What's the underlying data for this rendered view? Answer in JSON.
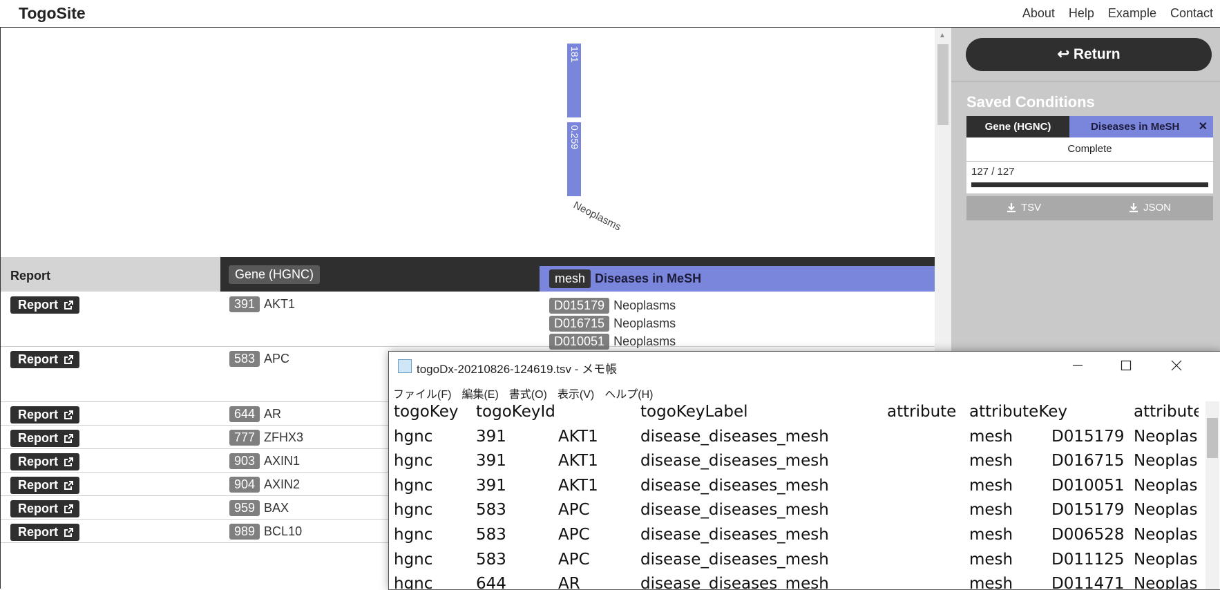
{
  "header": {
    "logo": "TogoSite",
    "nav": [
      "About",
      "Help",
      "Example",
      "Contact"
    ]
  },
  "chart_data": {
    "type": "bar",
    "categories": [
      "Neoplasms"
    ],
    "bar_labels": [
      "181",
      "0.259"
    ],
    "colors": {
      "bar": "#7a86dc"
    }
  },
  "table": {
    "headers": {
      "report": "Report",
      "gene": "Gene (HGNC)",
      "mesh_prefix": "mesh",
      "mesh": "Diseases in MeSH"
    },
    "report_label": "Report",
    "rows": [
      {
        "gene_id": "391",
        "gene_symbol": "AKT1",
        "mesh": [
          {
            "id": "D015179",
            "label": "Neoplasms"
          },
          {
            "id": "D016715",
            "label": "Neoplasms"
          },
          {
            "id": "D010051",
            "label": "Neoplasms"
          }
        ]
      },
      {
        "gene_id": "583",
        "gene_symbol": "APC",
        "mesh": []
      },
      {
        "gene_id": "644",
        "gene_symbol": "AR",
        "mesh": []
      },
      {
        "gene_id": "777",
        "gene_symbol": "ZFHX3",
        "mesh": []
      },
      {
        "gene_id": "903",
        "gene_symbol": "AXIN1",
        "mesh": []
      },
      {
        "gene_id": "904",
        "gene_symbol": "AXIN2",
        "mesh": []
      },
      {
        "gene_id": "959",
        "gene_symbol": "BAX",
        "mesh": []
      },
      {
        "gene_id": "989",
        "gene_symbol": "BCL10",
        "mesh": []
      }
    ]
  },
  "sidebar": {
    "return_label": "↩ Return",
    "saved_title": "Saved Conditions",
    "tab_gene": "Gene (HGNC)",
    "tab_mesh": "Diseases in MeSH",
    "close_symbol": "✕",
    "status": "Complete",
    "progress_text": "127 / 127",
    "progress_fraction": 1.0,
    "download_tsv": "TSV",
    "download_json": "JSON"
  },
  "notepad": {
    "title": "togoDx-20210826-124619.tsv - メモ帳",
    "menu": [
      "ファイル(F)",
      "編集(E)",
      "書式(O)",
      "表示(V)",
      "ヘルプ(H)"
    ],
    "lines": [
      [
        "togoKey",
        "togoKeyId",
        "",
        "togoKeyLabel",
        "attribute",
        "attributeKey",
        "",
        "attributeKeyId"
      ],
      [
        "hgnc",
        "391",
        "AKT1",
        "disease_diseases_mesh",
        "",
        "mesh",
        "D015179",
        "Neoplasms"
      ],
      [
        "hgnc",
        "391",
        "AKT1",
        "disease_diseases_mesh",
        "",
        "mesh",
        "D016715",
        "Neoplasms"
      ],
      [
        "hgnc",
        "391",
        "AKT1",
        "disease_diseases_mesh",
        "",
        "mesh",
        "D010051",
        "Neoplasms"
      ],
      [
        "hgnc",
        "583",
        "APC",
        "disease_diseases_mesh",
        "",
        "mesh",
        "D015179",
        "Neoplasms"
      ],
      [
        "hgnc",
        "583",
        "APC",
        "disease_diseases_mesh",
        "",
        "mesh",
        "D006528",
        "Neoplasms"
      ],
      [
        "hgnc",
        "583",
        "APC",
        "disease_diseases_mesh",
        "",
        "mesh",
        "D011125",
        "Neoplasms"
      ],
      [
        "hgnc",
        "644",
        "AR",
        "disease_diseases_mesh",
        "",
        "mesh",
        "D011471",
        "Neoplasms"
      ]
    ]
  }
}
